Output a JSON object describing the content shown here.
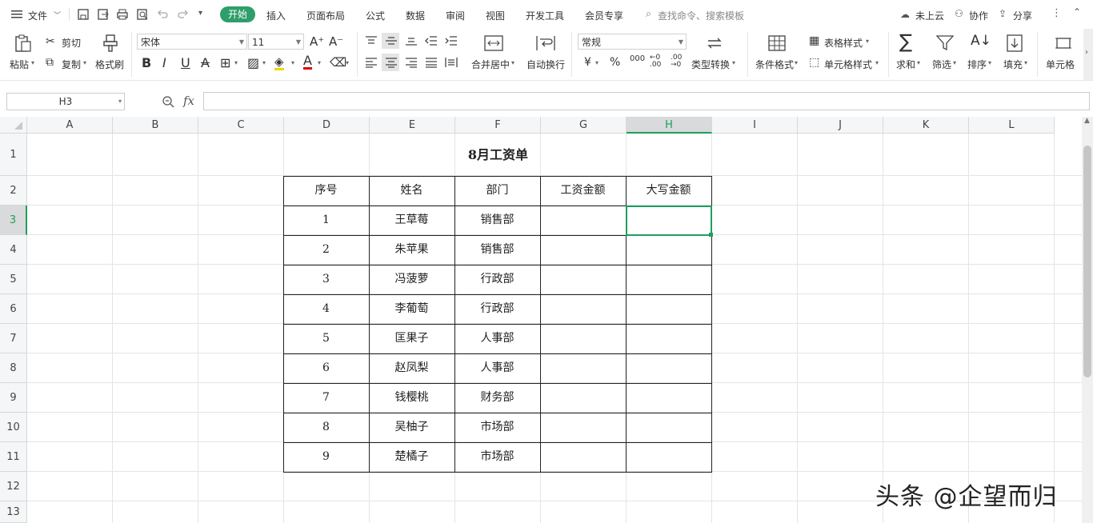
{
  "menu": {
    "file": "文件",
    "tabs": [
      "开始",
      "插入",
      "页面布局",
      "公式",
      "数据",
      "审阅",
      "视图",
      "开发工具",
      "会员专享"
    ],
    "search_placeholder": "查找命令、搜索模板",
    "cloud": "未上云",
    "collab": "协作",
    "share": "分享"
  },
  "ribbon": {
    "paste": "粘贴",
    "cut": "剪切",
    "copy": "复制",
    "format_painter": "格式刷",
    "font_name": "宋体",
    "font_size": "11",
    "merge_center": "合并居中",
    "wrap_text": "自动换行",
    "number_format": "常规",
    "type_convert": "类型转换",
    "cond_format": "条件格式",
    "table_style": "表格样式",
    "cell_style": "单元格样式",
    "sum": "求和",
    "filter": "筛选",
    "sort": "排序",
    "fill": "填充",
    "cell": "单元格"
  },
  "formula_bar": {
    "name_box": "H3",
    "fx": "fx",
    "value": ""
  },
  "columns": [
    "A",
    "B",
    "C",
    "D",
    "E",
    "F",
    "G",
    "H",
    "I",
    "J",
    "K",
    "L"
  ],
  "rows": [
    "1",
    "2",
    "3",
    "4",
    "5",
    "6",
    "7",
    "8",
    "9",
    "10",
    "11",
    "12",
    "13"
  ],
  "sheet": {
    "title": "8月工资单",
    "headers": [
      "序号",
      "姓名",
      "部门",
      "工资金额",
      "大写金额"
    ],
    "records": [
      {
        "no": "1",
        "name": "王草莓",
        "dept": "销售部"
      },
      {
        "no": "2",
        "name": "朱苹果",
        "dept": "销售部"
      },
      {
        "no": "3",
        "name": "冯菠萝",
        "dept": "行政部"
      },
      {
        "no": "4",
        "name": "李葡萄",
        "dept": "行政部"
      },
      {
        "no": "5",
        "name": "匡果子",
        "dept": "人事部"
      },
      {
        "no": "6",
        "name": "赵凤梨",
        "dept": "人事部"
      },
      {
        "no": "7",
        "name": "钱樱桃",
        "dept": "财务部"
      },
      {
        "no": "8",
        "name": "吴柚子",
        "dept": "市场部"
      },
      {
        "no": "9",
        "name": "楚橘子",
        "dept": "市场部"
      }
    ]
  },
  "watermark": "头条 @企望而归",
  "colors": {
    "accent": "#2e9e6a",
    "selection": "#1f9e5f"
  }
}
